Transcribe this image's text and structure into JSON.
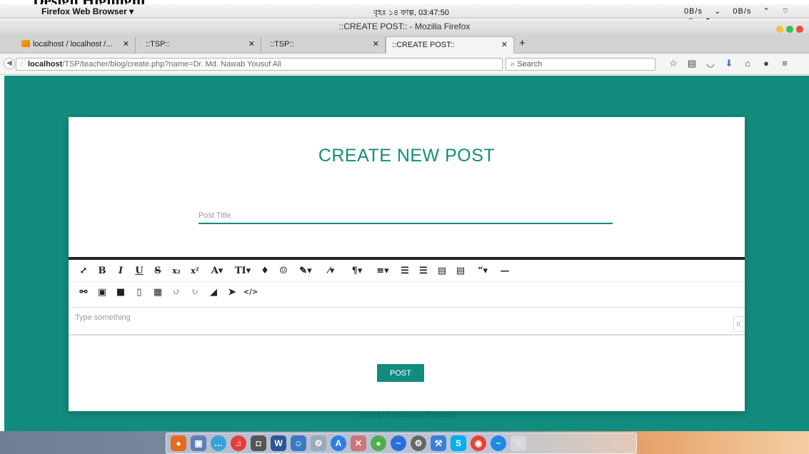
{
  "menubar": {
    "app_menu": "Firefox Web Browser ▾",
    "clock": "বৃহঃ ১৪ ফাল্গ, 03:47:50",
    "tray": [
      "0B/s",
      "0B/s"
    ]
  },
  "window": {
    "title": "::CREATE POST:: - Mozilla Firefox"
  },
  "tabs": [
    {
      "label": "localhost / localhost /...",
      "active": false
    },
    {
      "label": "::TSP::",
      "active": false
    },
    {
      "label": "::TSP::",
      "active": false
    },
    {
      "label": "::CREATE POST::",
      "active": true
    }
  ],
  "navbar": {
    "url_host": "localhost",
    "url_path": "/TSP/teacher/blog/create.php?name=Dr. Md. Nawab Yousuf Ali",
    "search_placeholder": "Search"
  },
  "page": {
    "heading": "CREATE NEW POST",
    "title_placeholder": "Post Title",
    "editor_placeholder": "Type something",
    "char_count": "0",
    "post_button": "POST",
    "copyright": "copyright ©Shovon Rahman"
  },
  "colors": {
    "accent": "#128c7e",
    "page_bg": "#128c7e",
    "card_bg": "#ffffff"
  }
}
